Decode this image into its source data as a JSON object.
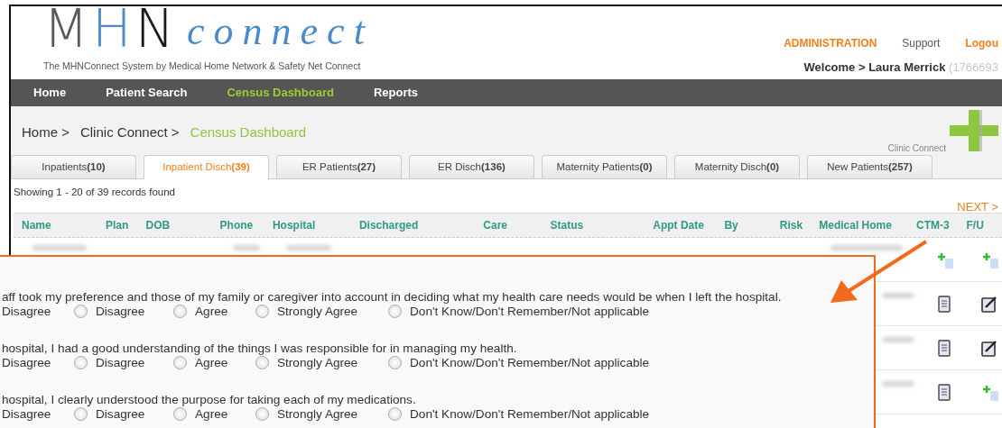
{
  "logo": {
    "letters": [
      "M",
      "H",
      "N"
    ],
    "word": "connect",
    "tagline": "The MHNConnect System by Medical Home Network & Safety Net Connect"
  },
  "top_links": [
    {
      "label": "ADMINISTRATION",
      "kind": "accent"
    },
    {
      "label": "Support",
      "kind": "plain"
    },
    {
      "label": "Logou",
      "kind": "accent"
    }
  ],
  "welcome": {
    "prefix": "Welcome > Laura Merrick",
    "id": "(1766693"
  },
  "nav": [
    {
      "label": "Home",
      "selected": false
    },
    {
      "label": "Patient Search",
      "selected": false
    },
    {
      "label": "Census Dashboard",
      "selected": true
    },
    {
      "label": "Reports",
      "selected": false
    }
  ],
  "breadcrumb": [
    {
      "label": "Home >",
      "current": false
    },
    {
      "label": "Clinic Connect >",
      "current": false
    },
    {
      "label": "Census Dashboard",
      "current": true
    }
  ],
  "clinic_logo": {
    "label": "Clinic Connect"
  },
  "tabs": [
    {
      "label": "Inpatients",
      "count": "(10)",
      "selected": false
    },
    {
      "label": "Inpatient Disch",
      "count": "(39)",
      "selected": true
    },
    {
      "label": "ER Patients",
      "count": "(27)",
      "selected": false
    },
    {
      "label": "ER Disch",
      "count": "(136)",
      "selected": false
    },
    {
      "label": "Maternity Patients",
      "count": "(0)",
      "selected": false
    },
    {
      "label": "Maternity Disch",
      "count": "(0)",
      "selected": false
    },
    {
      "label": "New Patients",
      "count": "(257)",
      "selected": false
    }
  ],
  "records": "Showing 1 - 20 of 39 records found",
  "next": "NEXT >",
  "table": {
    "columns": [
      "Name",
      "Plan",
      "DOB",
      "Phone",
      "Hospital",
      "Discharged",
      "Care",
      "Status",
      "Appt Date",
      "By",
      "Risk",
      "Medical Home",
      "CTM-3",
      "F/U"
    ],
    "rows": [
      {
        "icons": [
          {
            "kind": "add"
          },
          {
            "kind": "add"
          }
        ]
      },
      {
        "icons": [
          {
            "kind": "document"
          },
          {
            "kind": "edit"
          }
        ]
      },
      {
        "icons": [
          {
            "kind": "document"
          },
          {
            "kind": "edit"
          }
        ]
      },
      {
        "icons": [
          {
            "kind": "document"
          },
          {
            "kind": "add"
          }
        ]
      }
    ]
  },
  "survey": {
    "questions": [
      {
        "text": "aff took my preference and those of my family or caregiver into account in deciding what my health care needs would be when I left the hospital.",
        "options": [
          {
            "label": "Disagree",
            "kind": "cut"
          },
          {
            "label": "Disagree",
            "kind": "radio",
            "selected": false
          },
          {
            "label": "Agree",
            "kind": "radio",
            "selected": false
          },
          {
            "label": "Strongly Agree",
            "kind": "radio",
            "selected": false
          },
          {
            "label": "Don't Know/Don't Remember/Not applicable",
            "kind": "radio",
            "selected": false
          }
        ]
      },
      {
        "text": "hospital, I had a good understanding of the things I was responsible for in managing my health.",
        "options": [
          {
            "label": "Disagree",
            "kind": "cut"
          },
          {
            "label": "Disagree",
            "kind": "radio",
            "selected": false
          },
          {
            "label": "Agree",
            "kind": "radio",
            "selected": false
          },
          {
            "label": "Strongly Agree",
            "kind": "radio",
            "selected": false
          },
          {
            "label": "Don't Know/Don't Remember/Not applicable",
            "kind": "radio",
            "selected": false
          }
        ]
      },
      {
        "text": "hospital, I clearly understood the purpose for taking each of my medications.",
        "options": [
          {
            "label": "Disagree",
            "kind": "cut"
          },
          {
            "label": "Disagree",
            "kind": "radio",
            "selected": false
          },
          {
            "label": "Agree",
            "kind": "radio",
            "selected": false
          },
          {
            "label": "Strongly Agree",
            "kind": "radio",
            "selected": false
          },
          {
            "label": "Don't Know/Don't Remember/Not applicable",
            "kind": "radio",
            "selected": false
          }
        ]
      }
    ]
  }
}
